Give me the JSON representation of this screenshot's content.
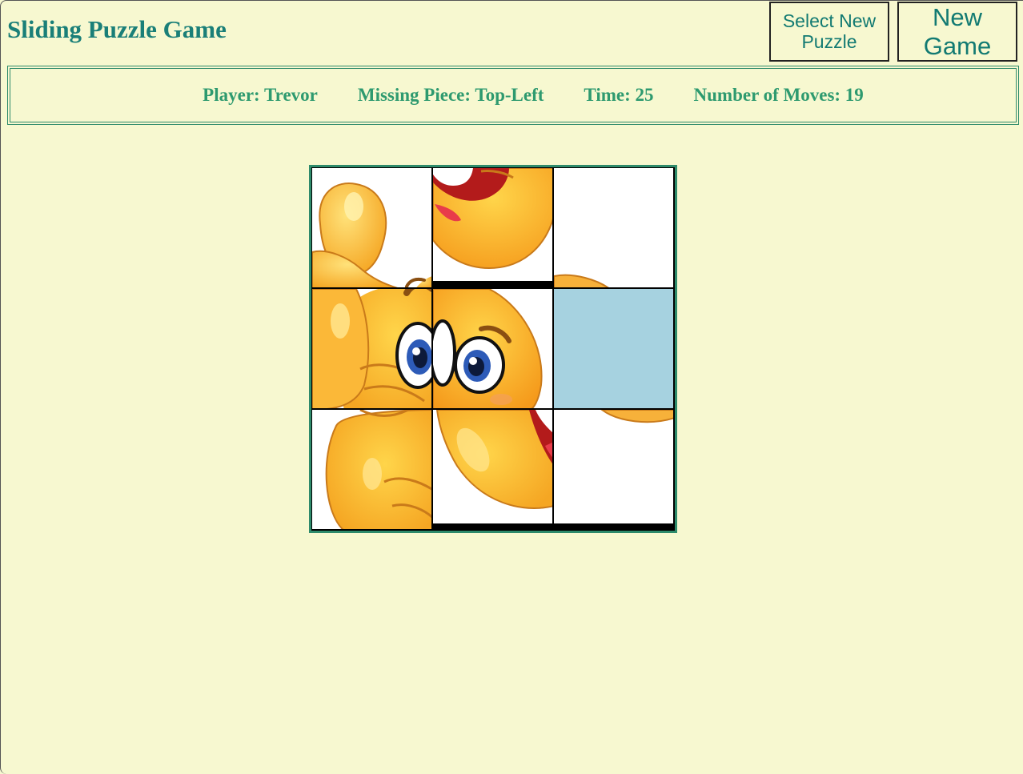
{
  "header": {
    "title": "Sliding Puzzle Game",
    "select_new_puzzle_label": "Select New Puzzle",
    "new_game_label": "New Game"
  },
  "status": {
    "player": "Player: Trevor",
    "missing_piece": "Missing Piece: Top-Left",
    "time": "Time: 25",
    "moves": "Number of Moves: 19"
  },
  "board": {
    "image": "winking-thumbs-up-emoji",
    "empty_tile_color": "#a6d2e0",
    "grid": [
      [
        "piece-1-1",
        "piece-2-2",
        "piece-1-3"
      ],
      [
        "piece-2-1",
        "piece-2-3",
        "empty"
      ],
      [
        "piece-3-1",
        "piece-3-2",
        "piece-3-3"
      ]
    ]
  },
  "colors": {
    "background": "#f7f8d0",
    "title": "#1a7f78",
    "info_text": "#2e9a6f",
    "border": "#2e8b6b"
  }
}
